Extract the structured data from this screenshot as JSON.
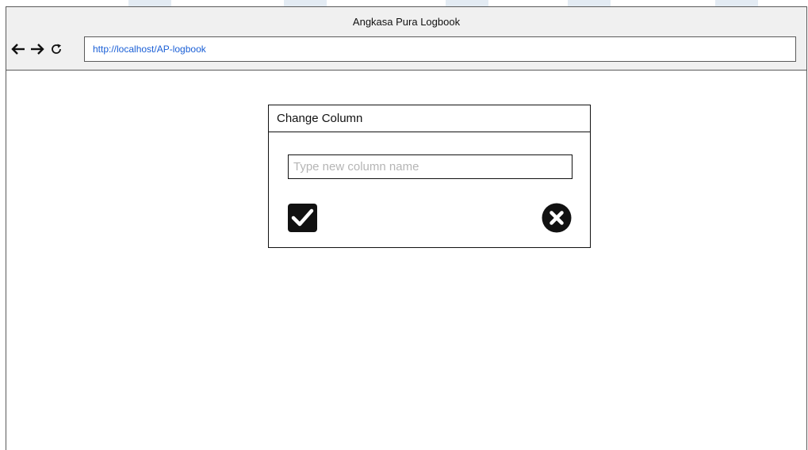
{
  "window": {
    "title": "Angkasa Pura Logbook"
  },
  "navbar": {
    "back_icon": "arrow-left-icon",
    "forward_icon": "arrow-right-icon",
    "reload_icon": "reload-icon",
    "url": "http://localhost/AP-logbook"
  },
  "dialog": {
    "title": "Change Column",
    "input": {
      "value": "",
      "placeholder": "Type new column name"
    },
    "confirm_icon": "checkbox-check-icon",
    "cancel_icon": "close-circle-icon"
  },
  "colors": {
    "url_text": "#1a5fd6",
    "watermark": "#e3ebf3",
    "border": "#5a5a5a"
  }
}
